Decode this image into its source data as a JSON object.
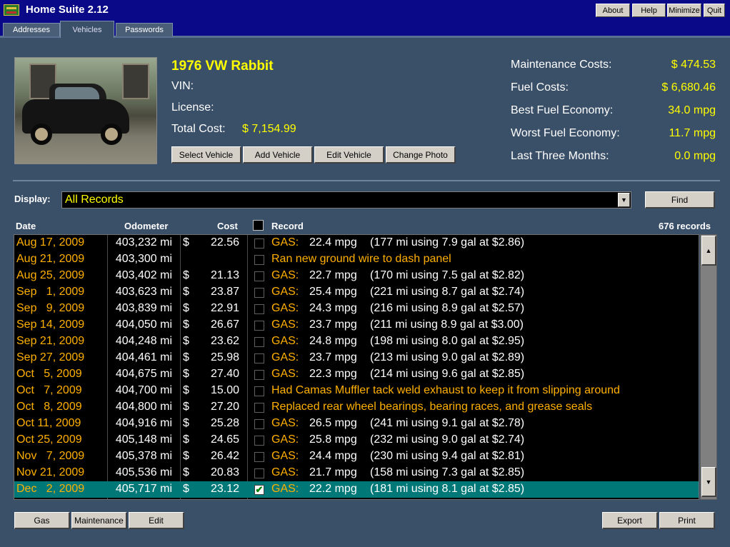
{
  "app": {
    "title": "Home Suite 2.12"
  },
  "window_buttons": {
    "about": "About",
    "help": "Help",
    "minimize": "Minimize",
    "quit": "Quit"
  },
  "tabs": [
    {
      "label": "Addresses"
    },
    {
      "label": "Vehicles"
    },
    {
      "label": "Passwords"
    }
  ],
  "vehicle": {
    "name": "1976 VW Rabbit",
    "vin_label": "VIN:",
    "vin_value": "",
    "license_label": "License:",
    "license_value": "",
    "total_cost_label": "Total Cost:",
    "total_cost_value": "$ 7,154.99"
  },
  "vehicle_buttons": {
    "select": "Select Vehicle",
    "add": "Add Vehicle",
    "edit": "Edit Vehicle",
    "change_photo": "Change Photo"
  },
  "stats": [
    {
      "label": "Maintenance Costs:",
      "value": "$ 474.53"
    },
    {
      "label": "Fuel Costs:",
      "value": "$ 6,680.46"
    },
    {
      "label": "Best Fuel Economy:",
      "value": "34.0 mpg"
    },
    {
      "label": "Worst Fuel Economy:",
      "value": "11.7 mpg"
    },
    {
      "label": "Last Three Months:",
      "value": "0.0 mpg"
    }
  ],
  "display": {
    "label": "Display:",
    "selected": "All Records",
    "find_label": "Find"
  },
  "table": {
    "headers": {
      "date": "Date",
      "odometer": "Odometer",
      "cost": "Cost",
      "record": "Record",
      "count": "676 records"
    },
    "rows": [
      {
        "date": "Aug 17, 2009",
        "odometer": "403,232 mi",
        "dollar": "$",
        "cost": "22.56",
        "checked": false,
        "type": "GAS:",
        "mpg": "22.4 mpg",
        "detail": "(177 mi using 7.9 gal at $2.86)"
      },
      {
        "date": "Aug 21, 2009",
        "odometer": "403,300 mi",
        "dollar": "",
        "cost": "",
        "checked": false,
        "note": "Ran new ground wire to dash panel"
      },
      {
        "date": "Aug 25, 2009",
        "odometer": "403,402 mi",
        "dollar": "$",
        "cost": "21.13",
        "checked": false,
        "type": "GAS:",
        "mpg": "22.7 mpg",
        "detail": "(170 mi using 7.5 gal at $2.82)"
      },
      {
        "date": "Sep   1, 2009",
        "odometer": "403,623 mi",
        "dollar": "$",
        "cost": "23.87",
        "checked": false,
        "type": "GAS:",
        "mpg": "25.4 mpg",
        "detail": "(221 mi using 8.7 gal at $2.74)"
      },
      {
        "date": "Sep   9, 2009",
        "odometer": "403,839 mi",
        "dollar": "$",
        "cost": "22.91",
        "checked": false,
        "type": "GAS:",
        "mpg": "24.3 mpg",
        "detail": "(216 mi using 8.9 gal at $2.57)"
      },
      {
        "date": "Sep 14, 2009",
        "odometer": "404,050 mi",
        "dollar": "$",
        "cost": "26.67",
        "checked": false,
        "type": "GAS:",
        "mpg": "23.7 mpg",
        "detail": "(211 mi using 8.9 gal at $3.00)"
      },
      {
        "date": "Sep 21, 2009",
        "odometer": "404,248 mi",
        "dollar": "$",
        "cost": "23.62",
        "checked": false,
        "type": "GAS:",
        "mpg": "24.8 mpg",
        "detail": "(198 mi using 8.0 gal at $2.95)"
      },
      {
        "date": "Sep 27, 2009",
        "odometer": "404,461 mi",
        "dollar": "$",
        "cost": "25.98",
        "checked": false,
        "type": "GAS:",
        "mpg": "23.7 mpg",
        "detail": "(213 mi using 9.0 gal at $2.89)"
      },
      {
        "date": "Oct   5, 2009",
        "odometer": "404,675 mi",
        "dollar": "$",
        "cost": "27.40",
        "checked": false,
        "type": "GAS:",
        "mpg": "22.3 mpg",
        "detail": "(214 mi using 9.6 gal at $2.85)"
      },
      {
        "date": "Oct   7, 2009",
        "odometer": "404,700 mi",
        "dollar": "$",
        "cost": "15.00",
        "checked": false,
        "note": "Had Camas Muffler tack weld exhaust to keep it from slipping around"
      },
      {
        "date": "Oct   8, 2009",
        "odometer": "404,800 mi",
        "dollar": "$",
        "cost": "27.20",
        "checked": false,
        "note": "Replaced rear wheel bearings, bearing races, and grease seals"
      },
      {
        "date": "Oct 11, 2009",
        "odometer": "404,916 mi",
        "dollar": "$",
        "cost": "25.28",
        "checked": false,
        "type": "GAS:",
        "mpg": "26.5 mpg",
        "detail": "(241 mi using 9.1 gal at $2.78)"
      },
      {
        "date": "Oct 25, 2009",
        "odometer": "405,148 mi",
        "dollar": "$",
        "cost": "24.65",
        "checked": false,
        "type": "GAS:",
        "mpg": "25.8 mpg",
        "detail": "(232 mi using 9.0 gal at $2.74)"
      },
      {
        "date": "Nov   7, 2009",
        "odometer": "405,378 mi",
        "dollar": "$",
        "cost": "26.42",
        "checked": false,
        "type": "GAS:",
        "mpg": "24.4 mpg",
        "detail": "(230 mi using 9.4 gal at $2.81)"
      },
      {
        "date": "Nov 21, 2009",
        "odometer": "405,536 mi",
        "dollar": "$",
        "cost": "20.83",
        "checked": false,
        "type": "GAS:",
        "mpg": "21.7 mpg",
        "detail": "(158 mi using 7.3 gal at $2.85)"
      },
      {
        "date": "Dec   2, 2009",
        "odometer": "405,717 mi",
        "dollar": "$",
        "cost": "23.12",
        "checked": true,
        "selected": true,
        "type": "GAS:",
        "mpg": "22.2 mpg",
        "detail": "(181 mi using 8.1 gal at $2.85)"
      }
    ]
  },
  "bottom_buttons": {
    "gas": "Gas",
    "maintenance": "Maintenance",
    "edit": "Edit",
    "export": "Export",
    "print": "Print"
  },
  "icons": {
    "scroll_up": "▲",
    "scroll_down": "▼",
    "dropdown": "▼",
    "check": "✔"
  }
}
